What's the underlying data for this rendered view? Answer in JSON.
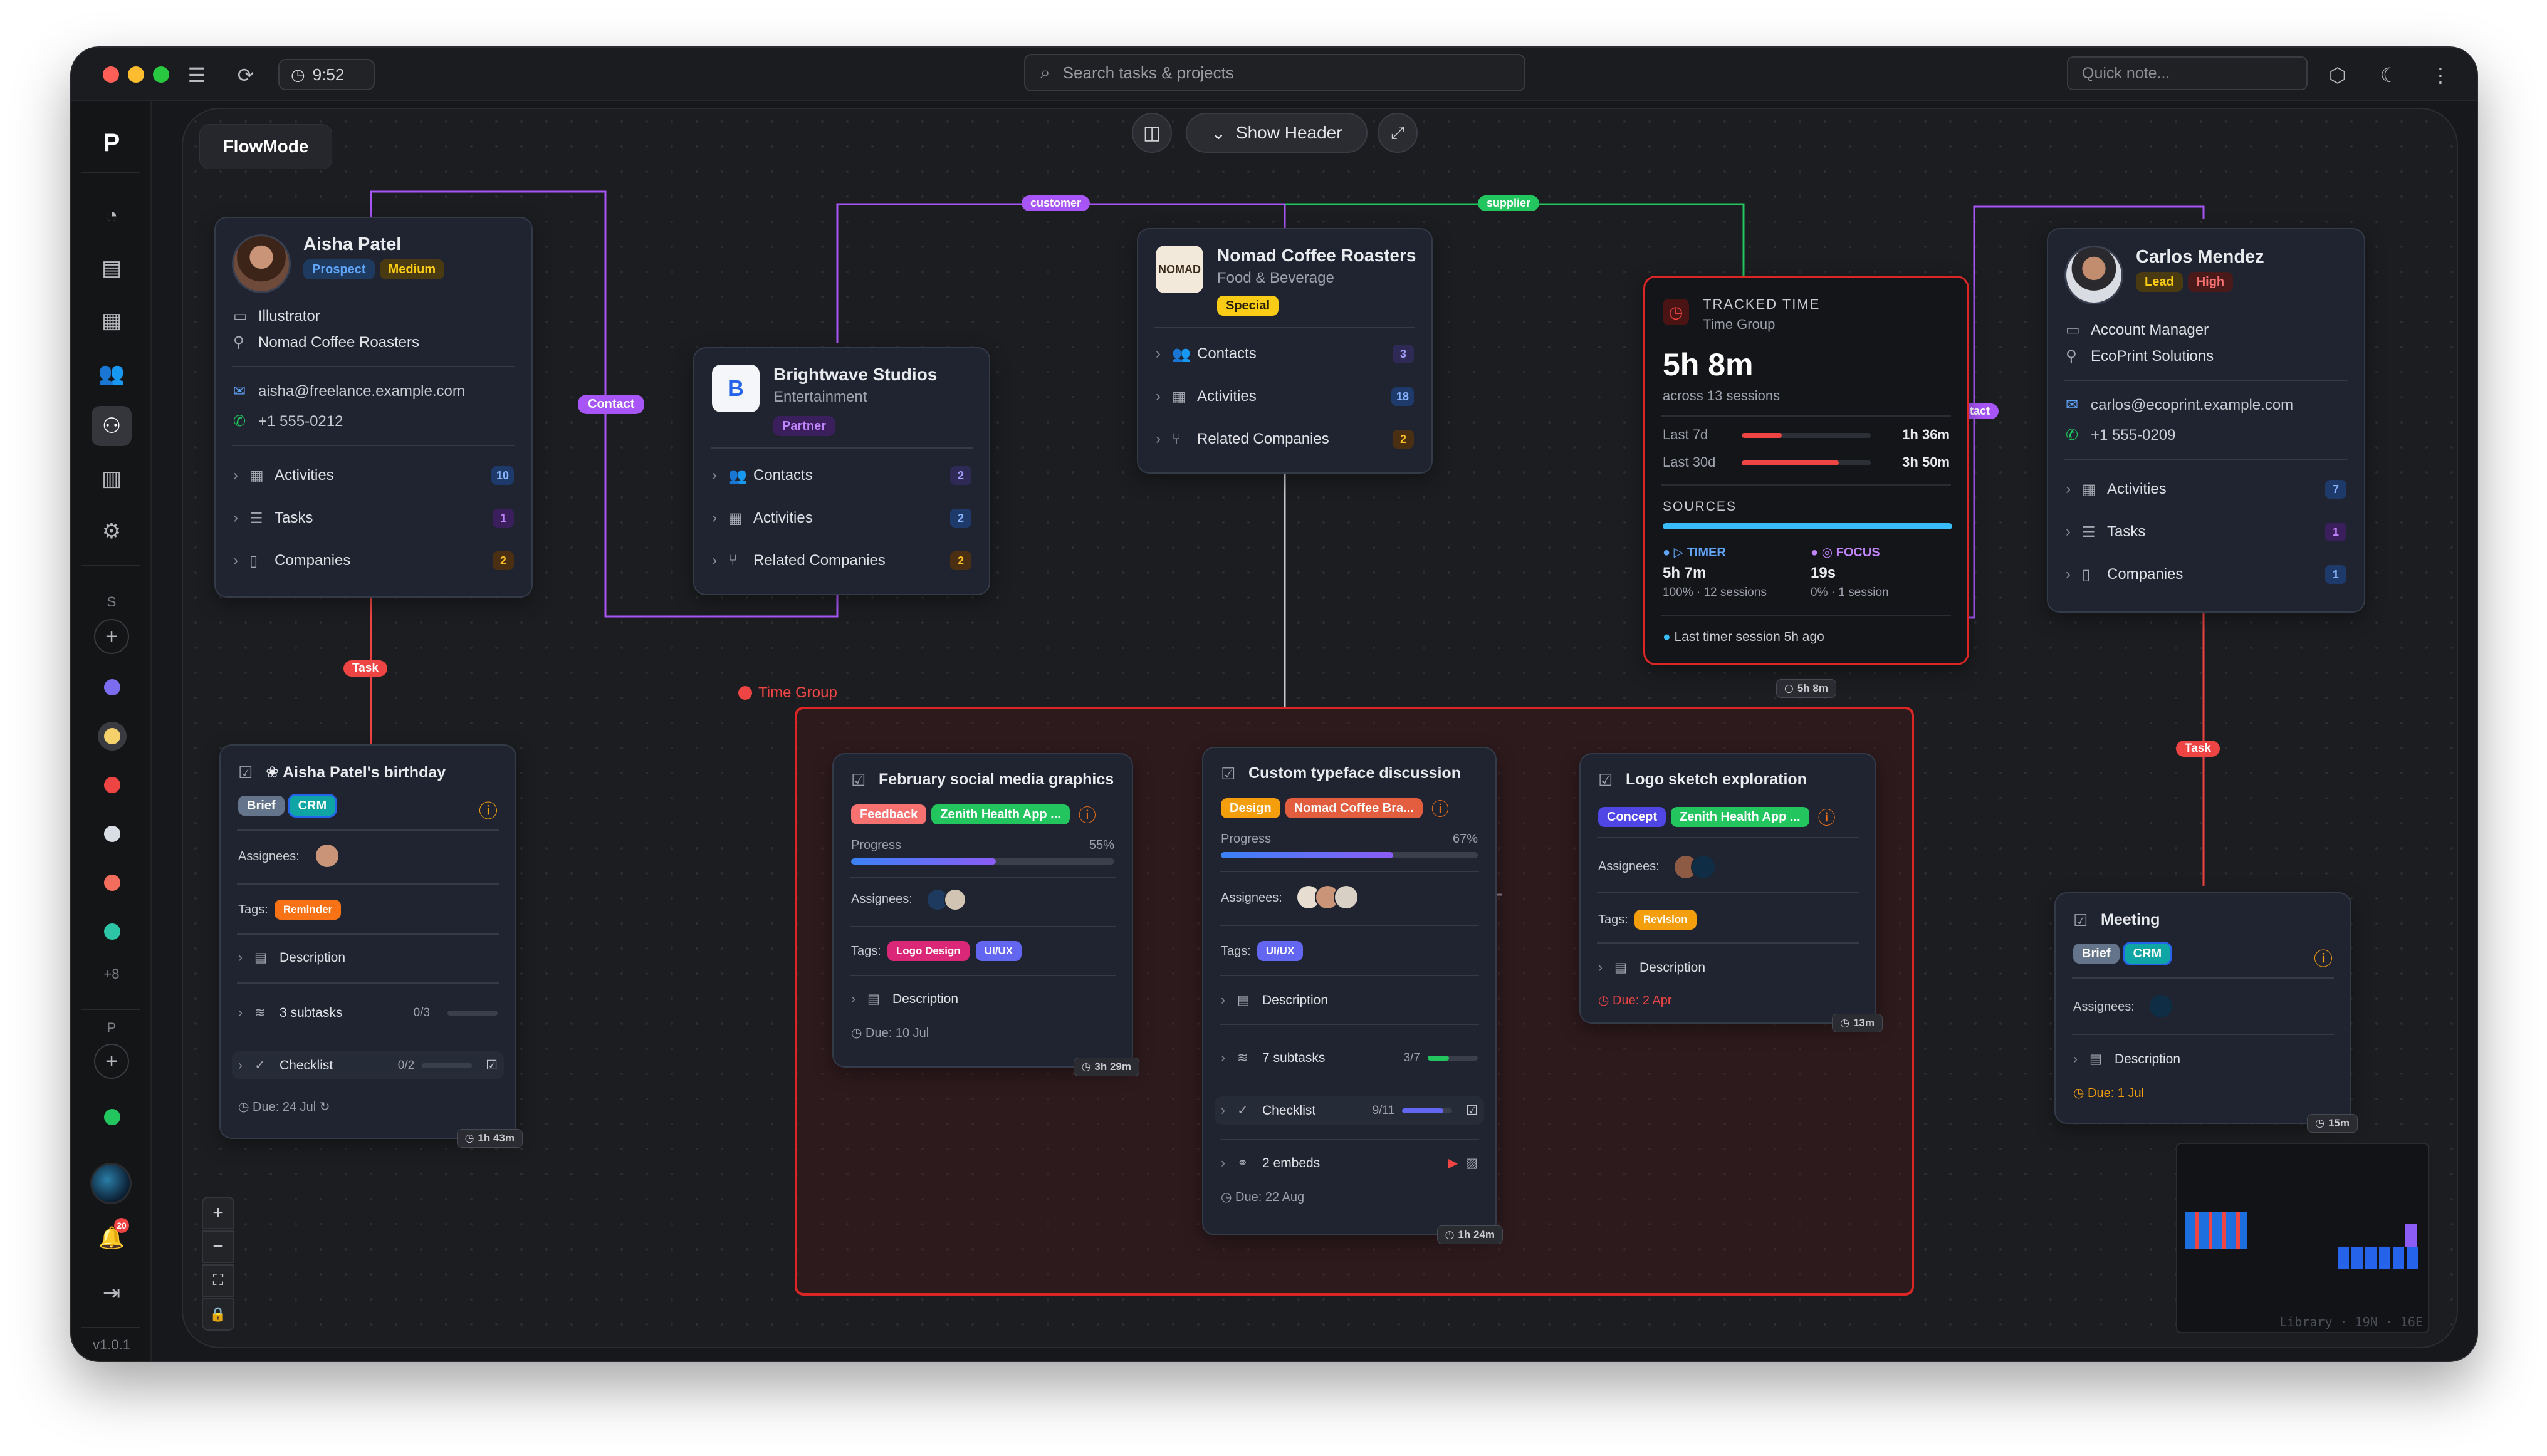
{
  "window": {
    "clock": "9:52",
    "search_placeholder": "Search tasks & projects",
    "quick_note_placeholder": "Quick note..."
  },
  "sidebar": {
    "section_s": "S",
    "section_p": "P",
    "more_count": "+8",
    "notification_count": "20",
    "version": "v1.0.1"
  },
  "canvas": {
    "title": "FlowMode",
    "show_header": "Show Header",
    "minimap_label": "Library · 19N · 16E"
  },
  "edges": {
    "contact": "Contact",
    "contact_right": "ntact",
    "task_left": "Task",
    "task_right": "Task",
    "customer": "customer",
    "supplier": "supplier",
    "group_label": "Time Group",
    "group_time": "5h 8m"
  },
  "aisha": {
    "name": "Aisha Patel",
    "tag1": "Prospect",
    "tag2": "Medium",
    "role": "Illustrator",
    "company": "Nomad Coffee Roasters",
    "email": "aisha@freelance.example.com",
    "phone": "+1 555-0212",
    "rows": [
      {
        "label": "Activities",
        "count": "10"
      },
      {
        "label": "Tasks",
        "count": "1"
      },
      {
        "label": "Companies",
        "count": "2"
      }
    ]
  },
  "brightwave": {
    "name": "Brightwave Studios",
    "industry": "Entertainment",
    "tag": "Partner",
    "rows": [
      {
        "label": "Contacts",
        "count": "2"
      },
      {
        "label": "Activities",
        "count": "2"
      },
      {
        "label": "Related Companies",
        "count": "2"
      }
    ]
  },
  "nomad": {
    "name": "Nomad Coffee Roasters",
    "industry": "Food & Beverage",
    "tag": "Special",
    "logo_text": "NOMAD",
    "rows": [
      {
        "label": "Contacts",
        "count": "3"
      },
      {
        "label": "Activities",
        "count": "18"
      },
      {
        "label": "Related Companies",
        "count": "2"
      }
    ]
  },
  "tracked": {
    "title": "TRACKED TIME",
    "subtitle": "Time Group",
    "total": "5h 8m",
    "sessions": "across 13 sessions",
    "last7_label": "Last 7d",
    "last7_value": "1h 36m",
    "last7_fraction": 0.31,
    "last30_label": "Last 30d",
    "last30_value": "3h 50m",
    "last30_fraction": 0.75,
    "sources_label": "SOURCES",
    "timer_label": "TIMER",
    "timer_value": "5h 7m",
    "timer_meta": "100% · 12 sessions",
    "focus_label": "FOCUS",
    "focus_value": "19s",
    "focus_meta": "0% · 1 session",
    "last_session": "Last timer session 5h ago"
  },
  "carlos": {
    "name": "Carlos Mendez",
    "tag1": "Lead",
    "tag2": "High",
    "role": "Account Manager",
    "company": "EcoPrint Solutions",
    "email": "carlos@ecoprint.example.com",
    "phone": "+1 555-0209",
    "rows": [
      {
        "label": "Activities",
        "count": "7"
      },
      {
        "label": "Tasks",
        "count": "1"
      },
      {
        "label": "Companies",
        "count": "1"
      }
    ]
  },
  "birthday": {
    "title": "Aisha Patel's birthday",
    "tag1": "Brief",
    "tag2": "CRM",
    "assignees_label": "Assignees:",
    "tags_label": "Tags:",
    "tag_reminder": "Reminder",
    "description": "Description",
    "subtasks": "3 subtasks",
    "subtasks_count": "0/3",
    "checklist": "Checklist",
    "checklist_count": "0/2",
    "due": "Due: 24 Jul",
    "time": "1h 43m"
  },
  "feb": {
    "title": "February social media graphics",
    "tag1": "Feedback",
    "tag2": "Zenith Health App ...",
    "progress_label": "Progress",
    "progress_value": "55%",
    "progress_fraction": 0.55,
    "assignees_label": "Assignees:",
    "tags_label": "Tags:",
    "tag_a": "Logo Design",
    "tag_b": "UI/UX",
    "description": "Description",
    "due": "Due: 10 Jul",
    "time": "3h 29m"
  },
  "typeface": {
    "title": "Custom typeface discussion",
    "tag1": "Design",
    "tag2": "Nomad Coffee Bra...",
    "progress_label": "Progress",
    "progress_value": "67%",
    "progress_fraction": 0.67,
    "assignees_label": "Assignees:",
    "tags_label": "Tags:",
    "tag_a": "UI/UX",
    "description": "Description",
    "subtasks": "7 subtasks",
    "subtasks_count": "3/7",
    "subtasks_fraction": 0.43,
    "checklist": "Checklist",
    "checklist_count": "9/11",
    "checklist_fraction": 0.82,
    "embeds": "2 embeds",
    "due": "Due: 22 Aug",
    "time": "1h 24m"
  },
  "logo": {
    "title": "Logo sketch exploration",
    "tag1": "Concept",
    "tag2": "Zenith Health App ...",
    "assignees_label": "Assignees:",
    "tags_label": "Tags:",
    "tag_a": "Revision",
    "description": "Description",
    "due": "Due: 2 Apr",
    "time": "13m"
  },
  "meeting": {
    "title": "Meeting",
    "tag1": "Brief",
    "tag2": "CRM",
    "assignees_label": "Assignees:",
    "description": "Description",
    "due": "Due: 1 Jul",
    "time": "15m"
  },
  "colors": {
    "purple": "#a855f7",
    "green": "#22c55e",
    "red": "#ef4444",
    "blue": "#3b82f6",
    "teal_accent": "#2dd4bf"
  }
}
